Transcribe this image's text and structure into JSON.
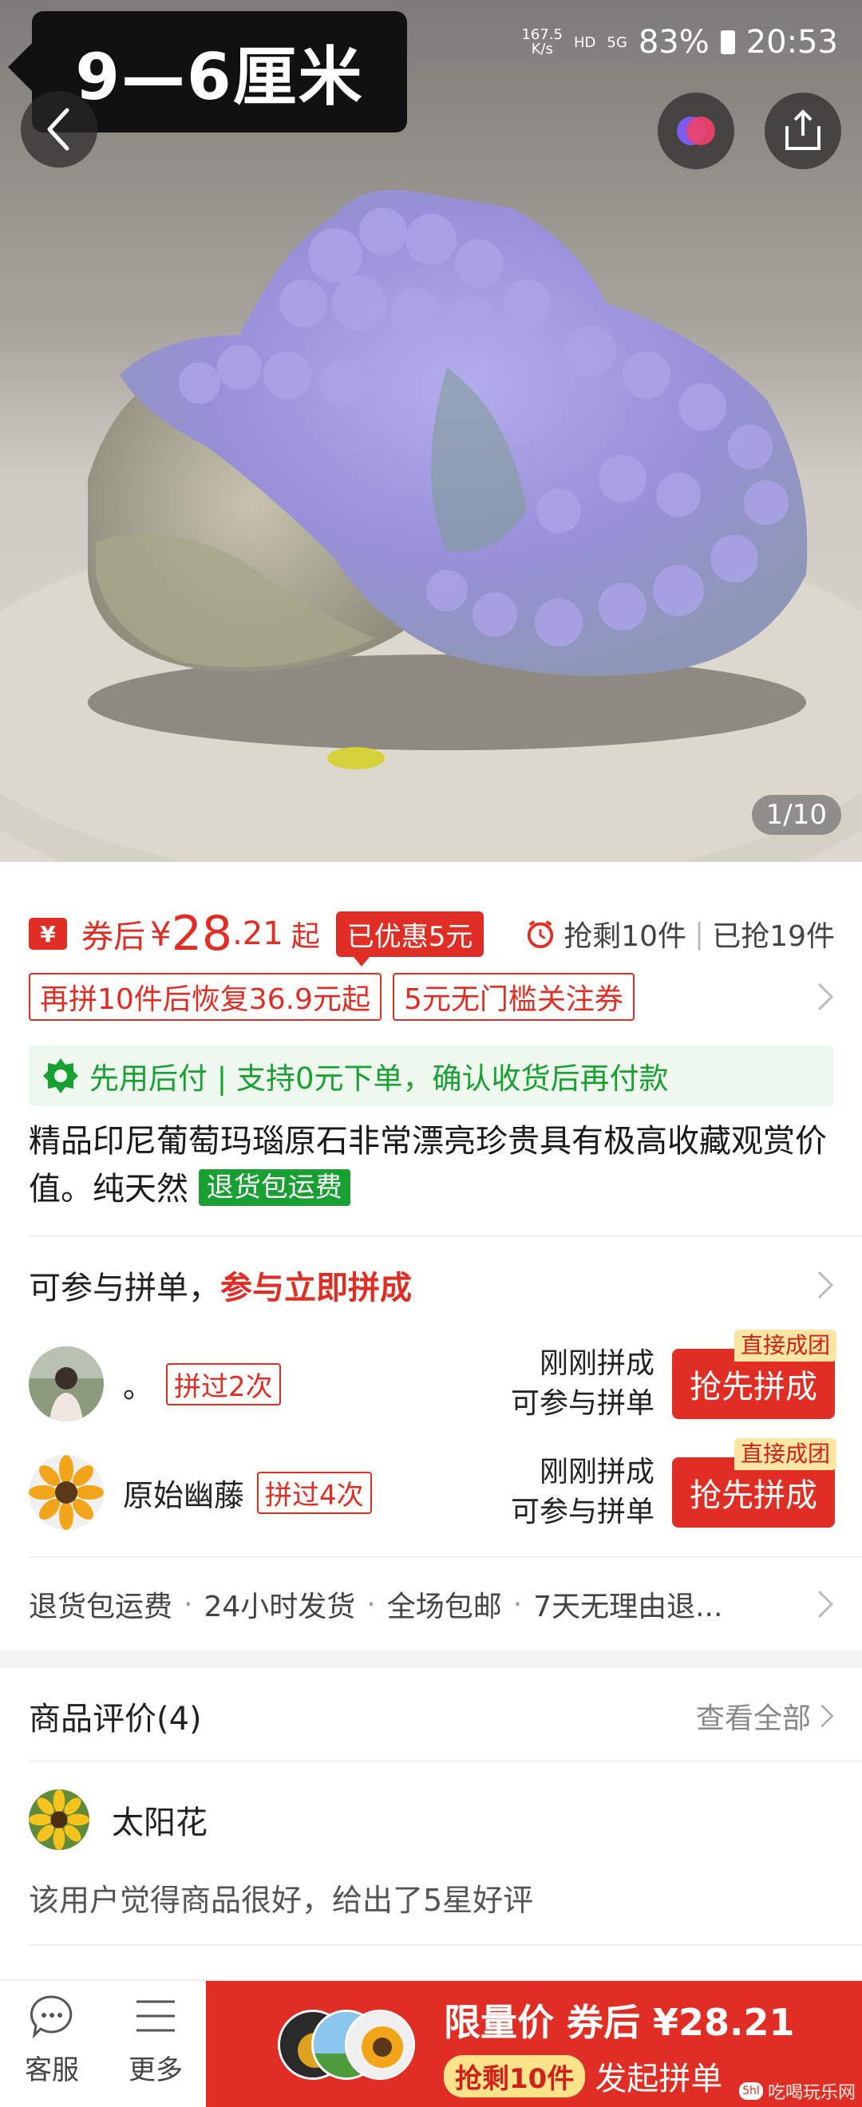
{
  "image": {
    "size_tag": "9—6厘米",
    "counter": "1/10"
  },
  "status_bar": {
    "net_speed_value": "167.5",
    "net_speed_unit": "K/s",
    "hd": "HD",
    "signal": "5G",
    "battery": "83%",
    "time": "20:53"
  },
  "price": {
    "icon": "¥",
    "label": "券后",
    "currency": "¥",
    "integer": "28",
    "decimal": ".21",
    "suffix": "起",
    "discount": "已优惠5元",
    "stock_left": "抢剩10件",
    "sold": "已抢19件"
  },
  "tags": [
    "再拼10件后恢复36.9元起",
    "5元无门槛关注券"
  ],
  "pay_later": "先用后付 | 支持0元下单，确认收货后再付款",
  "product": {
    "title": "精品印尼葡萄玛瑙原石非常漂亮珍贵具有极高收藏观赏价值。纯天然",
    "badge": "退货包运费"
  },
  "group_buy": {
    "head_text": "可参与拼单，",
    "head_emphasis": "参与立即拼成",
    "rows": [
      {
        "name": "。",
        "count": "拼过2次",
        "status1": "刚刚拼成",
        "status2": "可参与拼单",
        "button": "抢先拼成",
        "badge": "直接成团"
      },
      {
        "name": "原始幽藤",
        "count": "拼过4次",
        "status1": "刚刚拼成",
        "status2": "可参与拼单",
        "button": "抢先拼成",
        "badge": "直接成团"
      }
    ]
  },
  "services": [
    "退货包运费",
    "24小时发货",
    "全场包邮",
    "7天无理由退..."
  ],
  "reviews": {
    "title": "商品评价(4)",
    "view_all": "查看全部",
    "reviewer": "太阳花",
    "text": "该用户觉得商品很好，给出了5星好评"
  },
  "bottom": {
    "service": "客服",
    "more": "更多",
    "cta_line1": "限量价 券后 ¥28.21",
    "cta_pill": "抢剩10件",
    "cta_action": "发起拼单",
    "watermark": "吃喝玩乐网"
  },
  "colors": {
    "brand_red": "#e02e24",
    "pay_green": "#19a032",
    "badge_yellow": "#fce6a4"
  },
  "icons": [
    "back-icon",
    "brand-logo-icon",
    "share-icon",
    "yen-icon",
    "clock-icon",
    "leaf-icon",
    "chevron-right-icon",
    "chat-icon",
    "menu-icon"
  ]
}
